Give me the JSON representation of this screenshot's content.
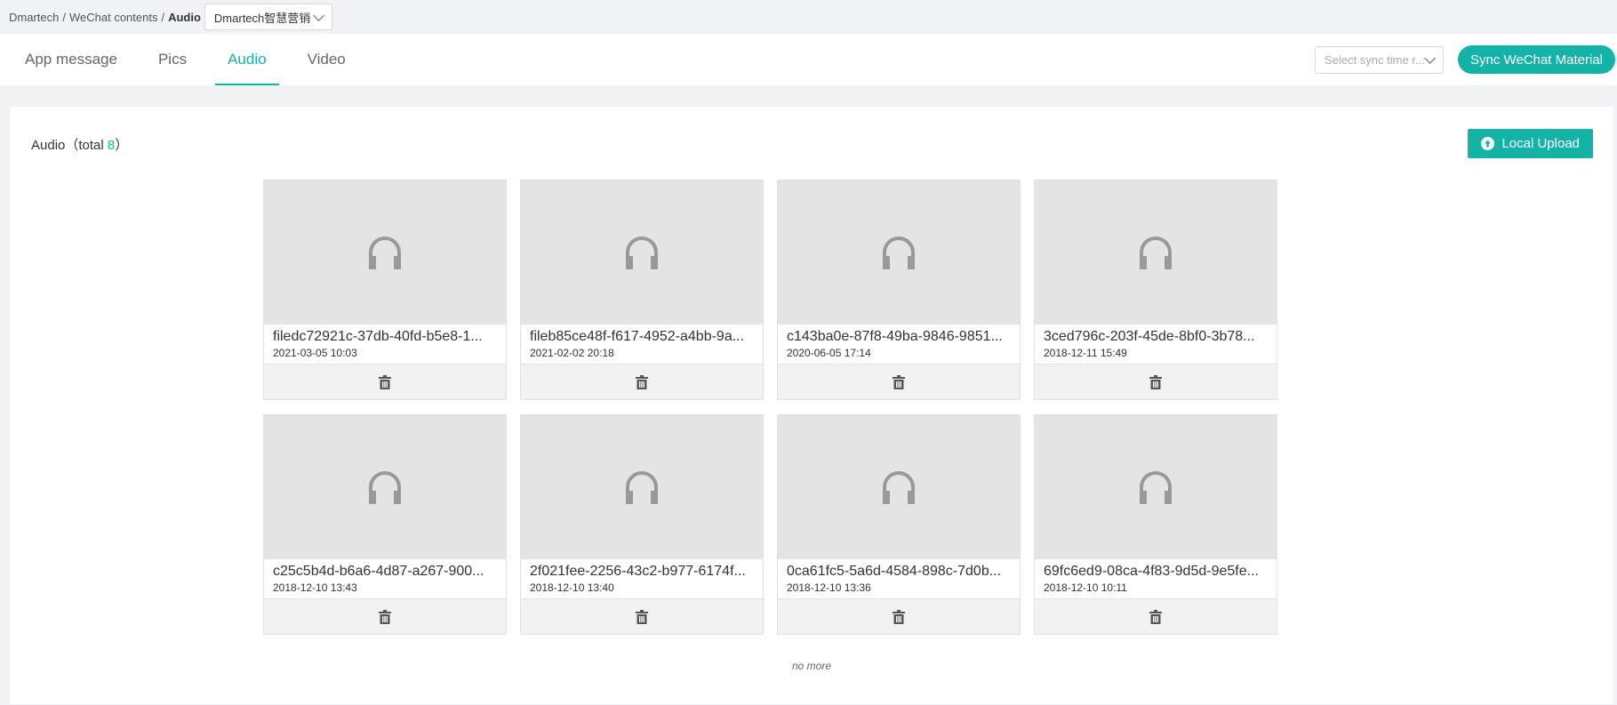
{
  "breadcrumb": {
    "items": [
      "Dmartech",
      "WeChat contents"
    ],
    "current": "Audio",
    "separator": "/"
  },
  "account_select": {
    "value": "Dmartech智慧营销"
  },
  "tabs": [
    {
      "label": "App message"
    },
    {
      "label": "Pics"
    },
    {
      "label": "Audio",
      "active": true
    },
    {
      "label": "Video"
    }
  ],
  "sync": {
    "placeholder": "Select sync time r...",
    "button_label": "Sync WeChat Material"
  },
  "panel": {
    "title_prefix": "Audio（total ",
    "total": "8",
    "title_suffix": "）",
    "upload_label": "Local Upload"
  },
  "audio_items": [
    {
      "name": "filedc72921c-37db-40fd-b5e8-1...",
      "date": "2021-03-05 10:03"
    },
    {
      "name": "fileb85ce48f-f617-4952-a4bb-9a...",
      "date": "2021-02-02 20:18"
    },
    {
      "name": "c143ba0e-87f8-49ba-9846-9851...",
      "date": "2020-06-05 17:14"
    },
    {
      "name": "3ced796c-203f-45de-8bf0-3b78...",
      "date": "2018-12-11 15:49"
    },
    {
      "name": "c25c5b4d-b6a6-4d87-a267-900...",
      "date": "2018-12-10 13:43"
    },
    {
      "name": "2f021fee-2256-43c2-b977-6174f...",
      "date": "2018-12-10 13:40"
    },
    {
      "name": "0ca61fc5-5a6d-4584-898c-7d0b...",
      "date": "2018-12-10 13:36"
    },
    {
      "name": "69fc6ed9-08ca-4f83-9d5d-9e5fe...",
      "date": "2018-12-10 10:11"
    }
  ],
  "footer": {
    "no_more": "no more"
  },
  "colors": {
    "accent": "#14b3a7",
    "thumb_bg": "#e4e4e4",
    "icon_gray": "#999999"
  },
  "icons": {
    "thumb": "headphones-icon",
    "delete": "trash-icon",
    "upload": "upload-icon",
    "dropdown": "chevron-down-icon"
  }
}
